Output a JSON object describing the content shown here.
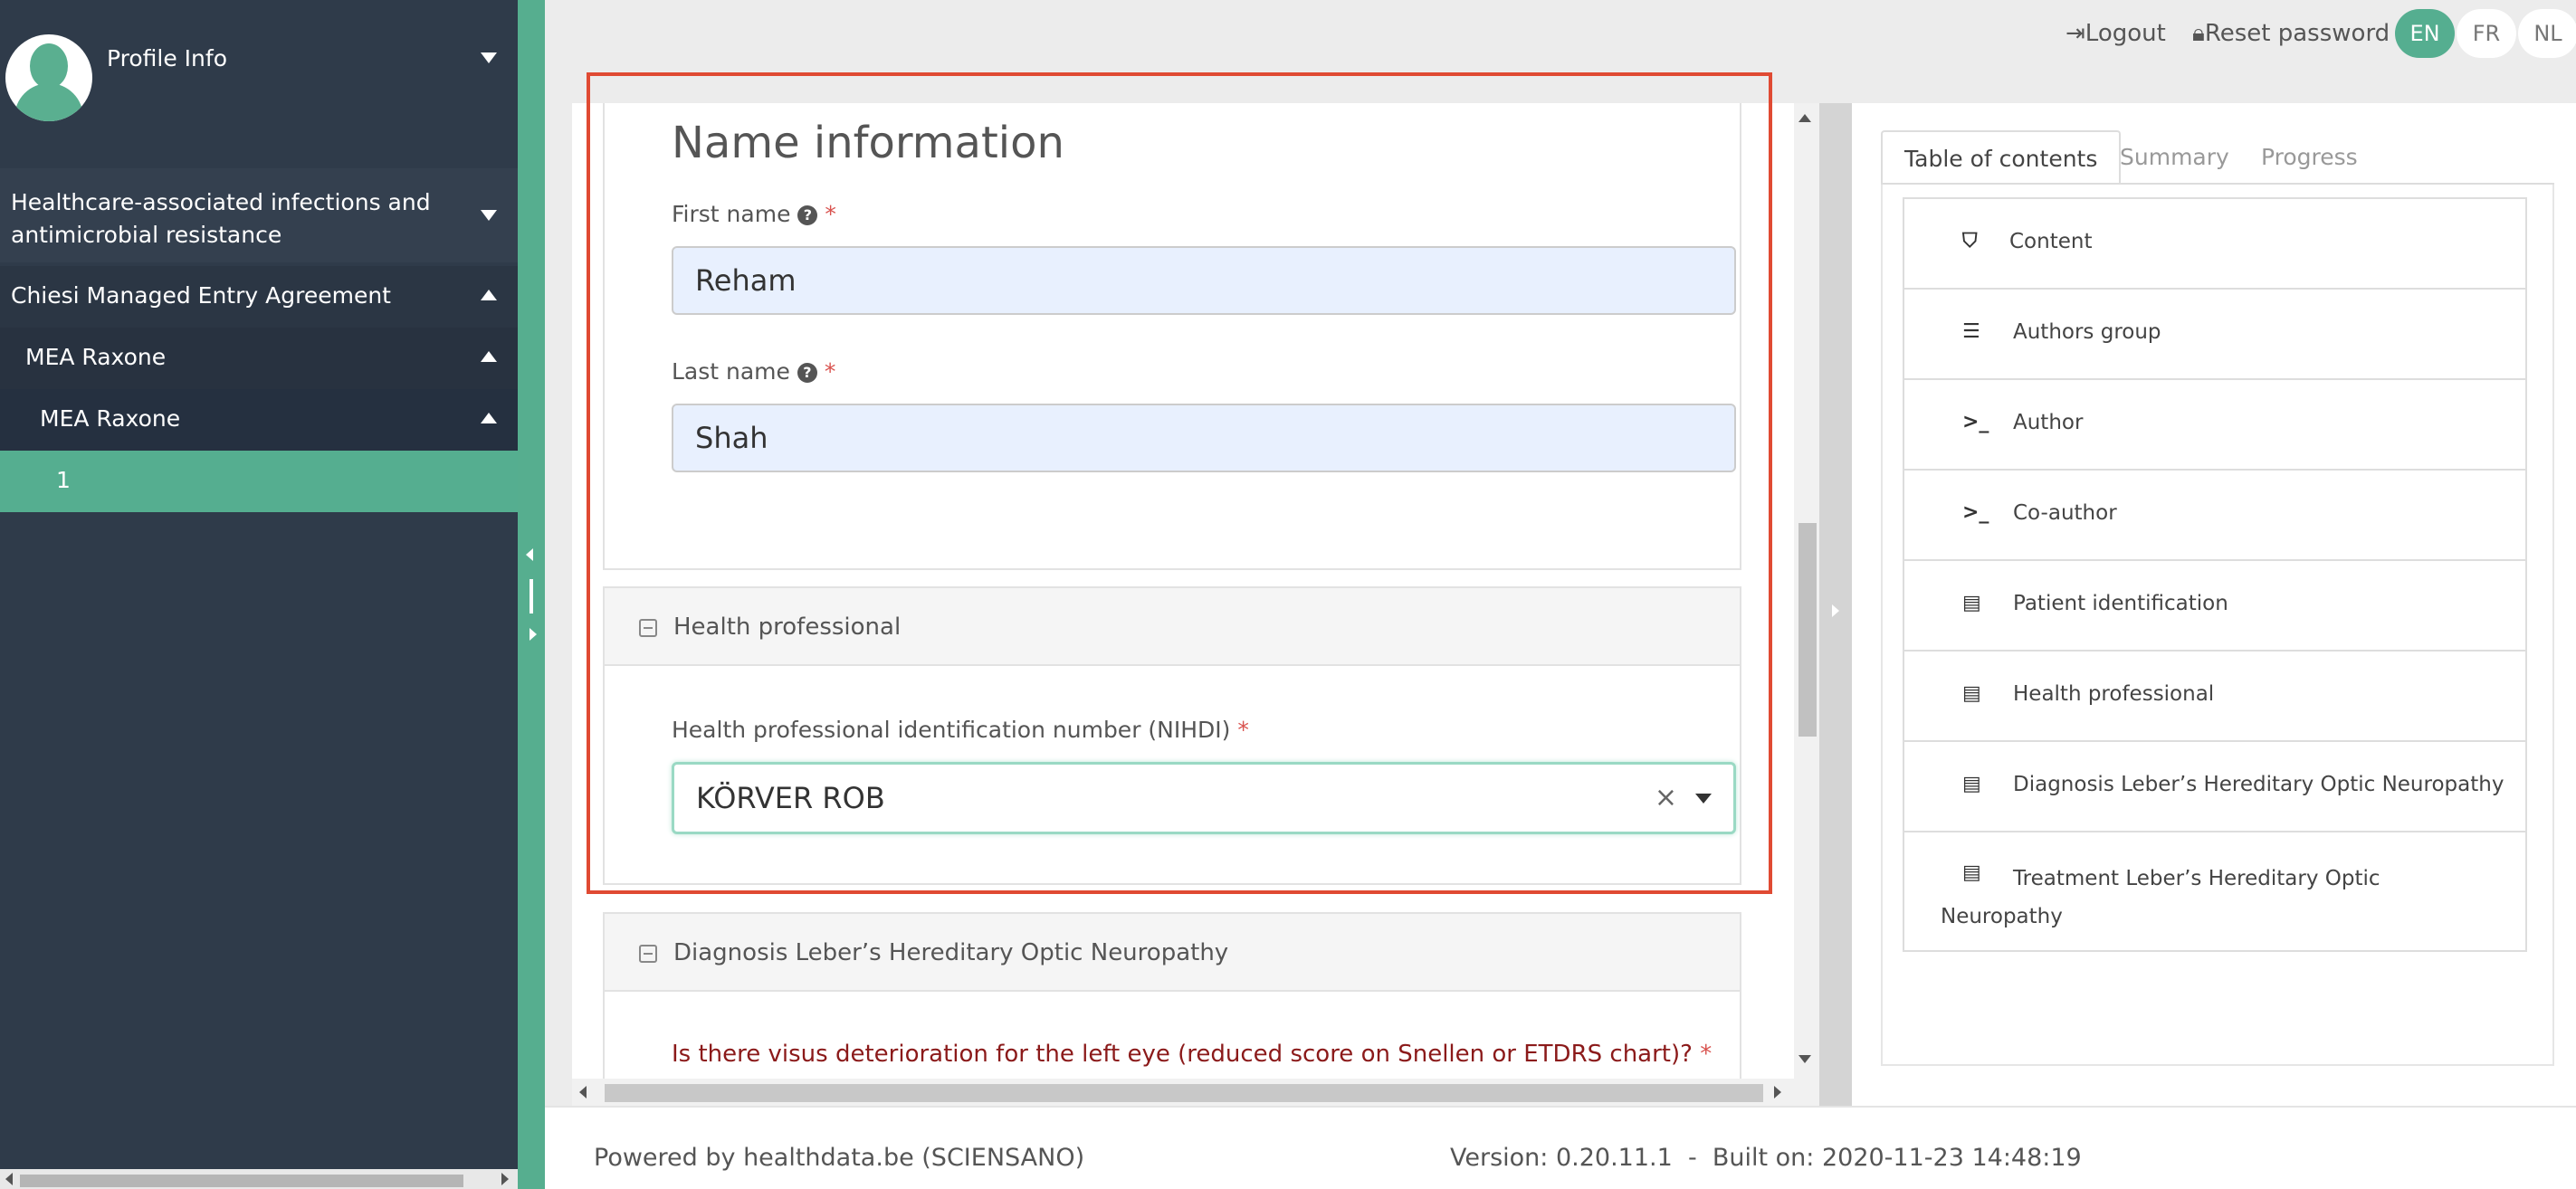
{
  "sidebar": {
    "profile_label": "Profile Info",
    "items": [
      {
        "label": "Healthcare-associated infections and antimicrobial resistance"
      },
      {
        "label": "Chiesi Managed Entry Agreement"
      },
      {
        "label": "MEA Raxone"
      },
      {
        "label": "MEA Raxone"
      },
      {
        "label": "1"
      }
    ]
  },
  "topbar": {
    "logout": "Logout",
    "reset_password": "Reset password",
    "languages": [
      "EN",
      "FR",
      "NL"
    ],
    "active_language": "EN"
  },
  "form": {
    "name_section": {
      "title": "Name information",
      "first_name_label": "First name",
      "first_name_value": "Reham",
      "last_name_label": "Last name",
      "last_name_value": "Shah"
    },
    "health_professional": {
      "title": "Health professional",
      "nihdi_label": "Health professional identification number (NIHDI)",
      "nihdi_value": "KÖRVER ROB"
    },
    "diagnosis": {
      "title": "Diagnosis Leber’s Hereditary Optic Neuropathy",
      "question": "Is there visus deterioration for the left eye (reduced score on Snellen or ETDRS chart)?"
    }
  },
  "toc": {
    "tabs": [
      "Table of contents",
      "Summary",
      "Progress"
    ],
    "active_tab": "Table of contents",
    "items": [
      {
        "label": "Content",
        "icon": "html5-icon"
      },
      {
        "label": "Authors group",
        "icon": "list-icon"
      },
      {
        "label": "Author",
        "icon": "terminal-icon"
      },
      {
        "label": "Co-author",
        "icon": "terminal-icon"
      },
      {
        "label": "Patient identification",
        "icon": "form-icon"
      },
      {
        "label": "Health professional",
        "icon": "form-icon"
      },
      {
        "label": "Diagnosis Leber’s Hereditary Optic Neuropathy",
        "icon": "form-icon"
      },
      {
        "label": "Treatment Leber’s Hereditary Optic Neuropathy",
        "icon": "form-icon"
      }
    ]
  },
  "footer": {
    "powered": "Powered by healthdata.be (SCIENSANO)",
    "version": "Version: 0.20.11.1  -  Built on: 2020-11-23 14:48:19"
  },
  "colors": {
    "accent": "#55ae90",
    "sidebar_bg": "#2f3b4a",
    "highlight": "#e04a33",
    "required": "#d9534f"
  }
}
